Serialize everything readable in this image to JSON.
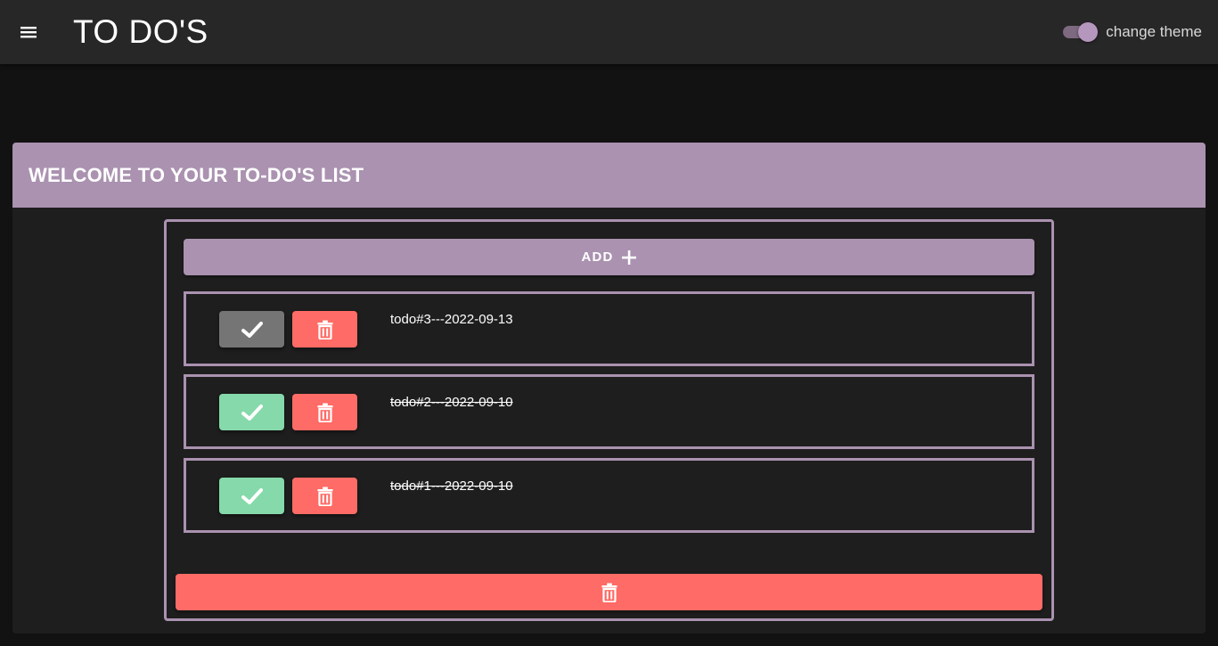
{
  "appbar": {
    "title": "TO DO'S",
    "menu_icon": "menu-icon",
    "theme_label": "change theme",
    "theme_on": true
  },
  "card": {
    "title": "WELCOME TO YOUR TO-DO'S LIST",
    "add_label": "ADD",
    "add_icon": "plus-icon"
  },
  "todos": [
    {
      "text": "todo#3---2022-09-13",
      "done": false
    },
    {
      "text": "todo#2---2022-09-10",
      "done": true
    },
    {
      "text": "todo#1---2022-09-10",
      "done": true
    }
  ],
  "colors": {
    "accent": "#aa92b0",
    "danger": "#ff6b66",
    "success": "#86d9aa",
    "pending": "#757575",
    "appbar": "#272727",
    "background": "#121212",
    "card": "#1e1e1e"
  }
}
